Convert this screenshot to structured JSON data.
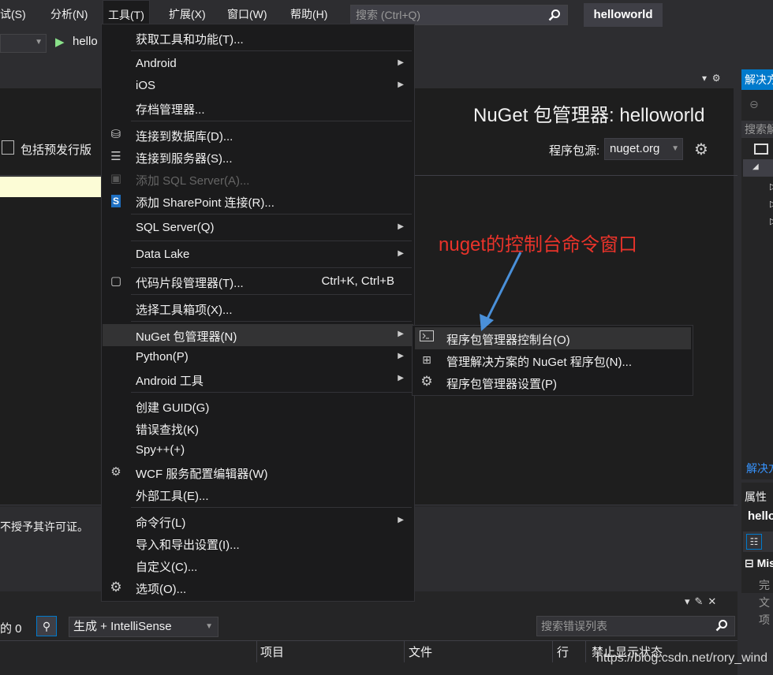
{
  "menubar": {
    "items": [
      {
        "label": "试(S)"
      },
      {
        "label": "分析(N)"
      },
      {
        "label": "工具(T)"
      },
      {
        "label": "扩展(X)"
      },
      {
        "label": "窗口(W)"
      },
      {
        "label": "帮助(H)"
      }
    ],
    "search_placeholder": "搜索 (Ctrl+Q)",
    "solution_name": "helloworld"
  },
  "toolbar": {
    "run_label": "hello"
  },
  "nuget": {
    "title": "NuGet 包管理器: helloworld",
    "prerelease_label": "包括预发行版",
    "package_source_label": "程序包源:",
    "package_source_value": "nuget.org"
  },
  "license_text": "不授予其许可证。",
  "tools_menu": {
    "items": [
      {
        "label": "获取工具和功能(T)..."
      },
      {
        "label": "Android"
      },
      {
        "label": "iOS"
      },
      {
        "label": "存档管理器..."
      },
      {
        "label": "连接到数据库(D)..."
      },
      {
        "label": "连接到服务器(S)..."
      },
      {
        "label": "添加 SQL Server(A)..."
      },
      {
        "label": "添加 SharePoint 连接(R)..."
      },
      {
        "label": "SQL Server(Q)"
      },
      {
        "label": "Data Lake"
      },
      {
        "label": "代码片段管理器(T)...",
        "shortcut": "Ctrl+K, Ctrl+B"
      },
      {
        "label": "选择工具箱项(X)..."
      },
      {
        "label": "NuGet 包管理器(N)"
      },
      {
        "label": "Python(P)"
      },
      {
        "label": "Android 工具"
      },
      {
        "label": "创建 GUID(G)"
      },
      {
        "label": "错误查找(K)"
      },
      {
        "label": "Spy++(+)"
      },
      {
        "label": "WCF 服务配置编辑器(W)"
      },
      {
        "label": "外部工具(E)..."
      },
      {
        "label": "命令行(L)"
      },
      {
        "label": "导入和导出设置(I)..."
      },
      {
        "label": "自定义(C)..."
      },
      {
        "label": "选项(O)..."
      }
    ]
  },
  "nuget_submenu": {
    "items": [
      {
        "label": "程序包管理器控制台(O)"
      },
      {
        "label": "管理解决方案的 NuGet 程序包(N)..."
      },
      {
        "label": "程序包管理器设置(P)"
      }
    ]
  },
  "annotation": "nuget的控制台命令窗口",
  "solution_explorer": {
    "tab_label": "解决方案资源管理器",
    "search_placeholder": "搜索解决方案资源管理器",
    "footer": "解决方案资源管理器"
  },
  "properties": {
    "title": "属性",
    "name": "helloworld",
    "category": "Misc",
    "rows": [
      "完",
      "文",
      "项"
    ]
  },
  "error_list": {
    "count_label": "的 0",
    "build_filter": "生成 + IntelliSense",
    "search_placeholder": "搜索错误列表",
    "columns": [
      "项目",
      "文件",
      "行",
      "禁止显示状态"
    ]
  },
  "watermark": "https://blog.csdn.net/rory_wind",
  "colors": {
    "accent": "#007acc",
    "annotation": "#e8332a",
    "menu_bg": "#1b1b1c",
    "highlight": "#333334"
  }
}
